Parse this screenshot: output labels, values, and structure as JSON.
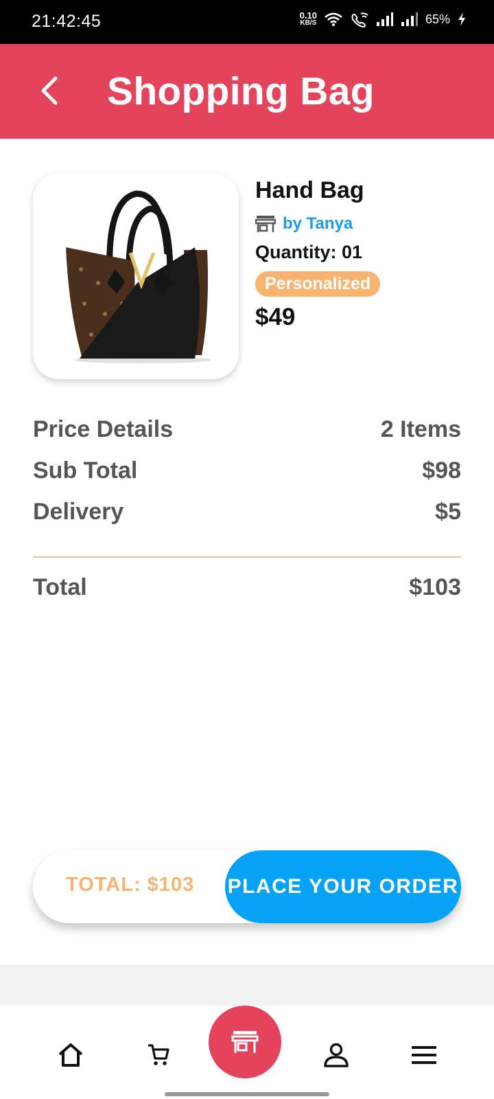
{
  "status_bar": {
    "time": "21:42:45",
    "net_speed_value": "0.10",
    "net_speed_unit": "KB/S",
    "battery": "65%",
    "icons": [
      "wifi-icon",
      "wifi-calling-icon",
      "signal-icon",
      "signal-icon",
      "charging-icon"
    ]
  },
  "header": {
    "title": "Shopping Bag",
    "back_icon": "back-arrow-icon"
  },
  "product": {
    "name": "Hand Bag",
    "seller": "by Tanya",
    "seller_icon": "store-icon",
    "quantity": "Quantity: 01",
    "badge": "Personalized",
    "price": "$49",
    "image_icon": "handbag-image"
  },
  "price_details": {
    "label": "Price Details",
    "items": "2 Items",
    "subtotal_label": "Sub Total",
    "subtotal_value": "$98",
    "delivery_label": "Delivery",
    "delivery_value": "$5",
    "total_label": "Total",
    "total_value": "$103"
  },
  "order_bar": {
    "total_text": "TOTAL: $103",
    "button_label": "PLACE YOUR ORDER"
  },
  "bottom_nav": {
    "items": [
      {
        "icon": "home-icon"
      },
      {
        "icon": "cart-icon"
      },
      {
        "icon": "store-icon"
      },
      {
        "icon": "profile-icon"
      },
      {
        "icon": "menu-icon"
      }
    ]
  },
  "colors": {
    "accent_red": "#e4435c",
    "accent_blue": "#05a2f5",
    "accent_orange": "#f8b36e",
    "seller_blue": "#1e9be6"
  }
}
